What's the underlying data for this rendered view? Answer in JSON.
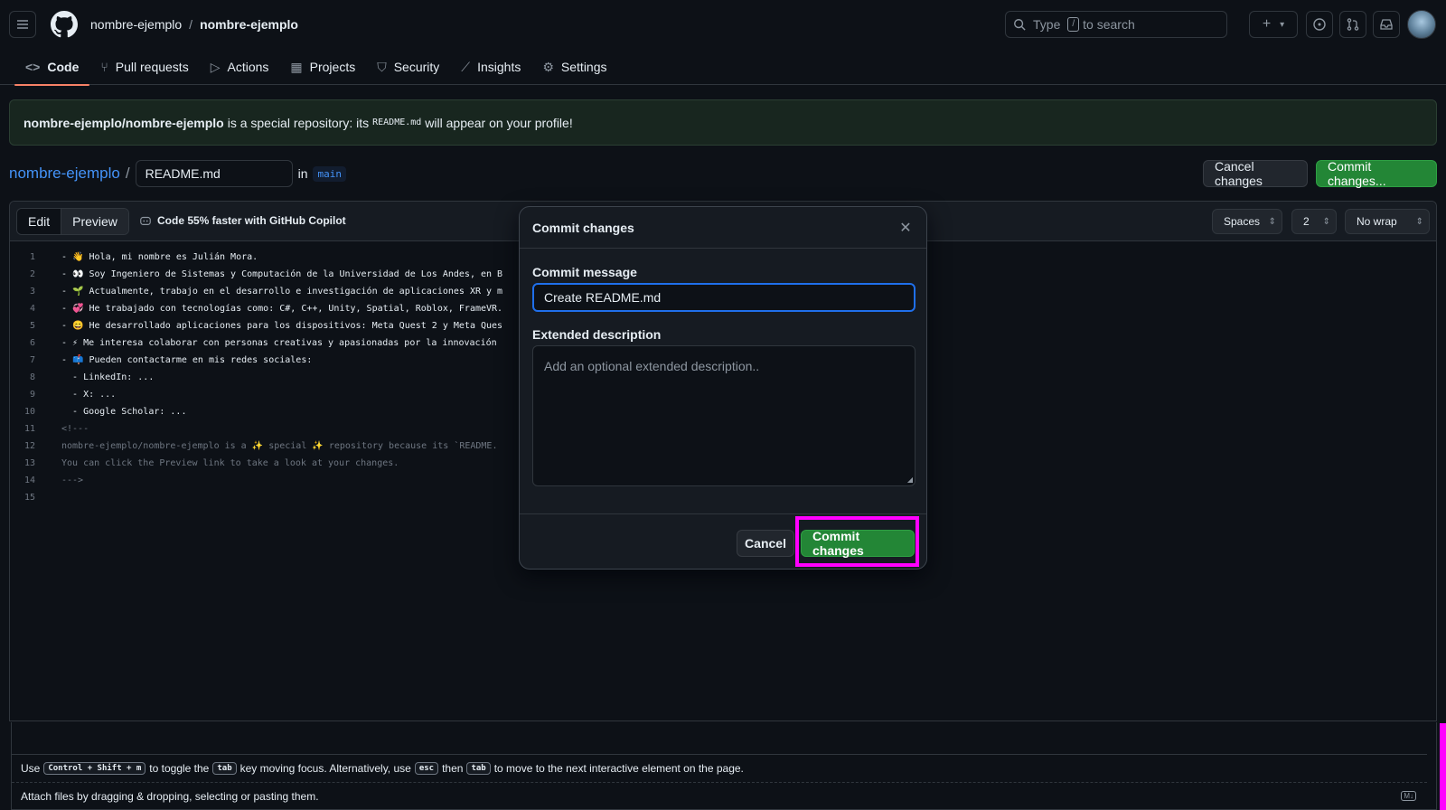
{
  "header": {
    "owner": "nombre-ejemplo",
    "separator": "/",
    "repo": "nombre-ejemplo",
    "search_prefix": "Type",
    "search_key": "/",
    "search_suffix": "to search",
    "plus": "+",
    "caret": "▾"
  },
  "tabs": [
    {
      "label": "Code",
      "icon": "code-icon",
      "glyph": "<>"
    },
    {
      "label": "Pull requests",
      "icon": "pull-request-icon",
      "glyph": "⑂"
    },
    {
      "label": "Actions",
      "icon": "play-icon",
      "glyph": "▷"
    },
    {
      "label": "Projects",
      "icon": "table-icon",
      "glyph": "▦"
    },
    {
      "label": "Security",
      "icon": "shield-icon",
      "glyph": "⛉"
    },
    {
      "label": "Insights",
      "icon": "graph-icon",
      "glyph": "⟋"
    },
    {
      "label": "Settings",
      "icon": "gear-icon",
      "glyph": "⚙"
    }
  ],
  "banner": {
    "repo": "nombre-ejemplo/nombre-ejemplo",
    "text1": "is a special repository: its",
    "file": "README.md",
    "text2": "will appear on your profile!"
  },
  "path": {
    "repo_link": "nombre-ejemplo",
    "slash": "/",
    "filename": "README.md",
    "in": "in",
    "branch": "main"
  },
  "actions": {
    "cancel": "Cancel changes",
    "commit": "Commit changes..."
  },
  "editor": {
    "edit_tab": "Edit",
    "preview_tab": "Preview",
    "copilot": "Code 55% faster with GitHub Copilot",
    "indent_mode": "Spaces",
    "indent_size": "2",
    "wrap_mode": "No wrap",
    "lines": [
      {
        "n": "1",
        "t": "- 👋 Hola, mi nombre es Julián Mora.",
        "c": false
      },
      {
        "n": "2",
        "t": "- 👀 Soy Ingeniero de Sistemas y Computación de la Universidad de Los Andes, en B",
        "c": false
      },
      {
        "n": "3",
        "t": "- 🌱 Actualmente, trabajo en el desarrollo e investigación de aplicaciones XR y m",
        "c": false
      },
      {
        "n": "4",
        "t": "- 💞️ He trabajado con tecnologías como: C#, C++, Unity, Spatial, Roblox, FrameVR.",
        "c": false
      },
      {
        "n": "5",
        "t": "- 😄 He desarrollado aplicaciones para los dispositivos: Meta Quest 2 y Meta Ques",
        "c": false
      },
      {
        "n": "6",
        "t": "- ⚡ Me interesa colaborar con personas creativas y apasionadas por la innovación",
        "c": false
      },
      {
        "n": "7",
        "t": "- 📫 Pueden contactarme en mis redes sociales:",
        "c": false
      },
      {
        "n": "8",
        "t": "  - LinkedIn: ...",
        "c": false
      },
      {
        "n": "9",
        "t": "  - X: ...",
        "c": false
      },
      {
        "n": "10",
        "t": "  - Google Scholar: ...",
        "c": false
      },
      {
        "n": "11",
        "t": "<!---",
        "c": true
      },
      {
        "n": "12",
        "t": "nombre-ejemplo/nombre-ejemplo is a ✨ special ✨ repository because its `README.",
        "c": true
      },
      {
        "n": "13",
        "t": "You can click the Preview link to take a look at your changes.",
        "c": true
      },
      {
        "n": "14",
        "t": "--->",
        "c": true
      },
      {
        "n": "15",
        "t": "",
        "c": false
      }
    ]
  },
  "help": {
    "use": "Use",
    "k1": "Control + Shift + m",
    "mid1": "to toggle the",
    "k2": "tab",
    "mid2": "key moving focus. Alternatively, use",
    "k3": "esc",
    "mid3": "then",
    "k4": "tab",
    "end": "to move to the next interactive element on the page.",
    "attach": "Attach files by dragging & dropping, selecting or pasting them.",
    "md": "M↓"
  },
  "modal": {
    "title": "Commit changes",
    "close": "✕",
    "message_label": "Commit message",
    "message_value": "Create README.md",
    "desc_label": "Extended description",
    "desc_placeholder": "Add an optional extended description..",
    "cancel": "Cancel",
    "commit": "Commit changes"
  },
  "colors": {
    "accent": "#238636",
    "highlight": "#ff00ff",
    "link": "#4493f8"
  }
}
